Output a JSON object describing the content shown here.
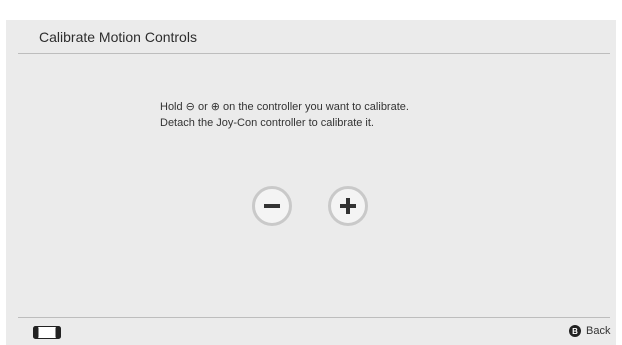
{
  "header": {
    "title": "Calibrate Motion Controls"
  },
  "instructions": {
    "line1": "Hold ⊖ or ⊕ on the controller you want to calibrate.",
    "line2": "Detach the Joy-Con controller to calibrate it."
  },
  "buttons": [
    {
      "icon": "minus-icon"
    },
    {
      "icon": "plus-icon"
    }
  ],
  "footer": {
    "console_icon": "handheld-console-icon",
    "back_button_glyph": "B",
    "back_label": "Back"
  },
  "colors": {
    "background": "#ebebeb",
    "divider": "#bdbdbd",
    "button_ring": "#c9c9c9",
    "icon": "#333333"
  }
}
